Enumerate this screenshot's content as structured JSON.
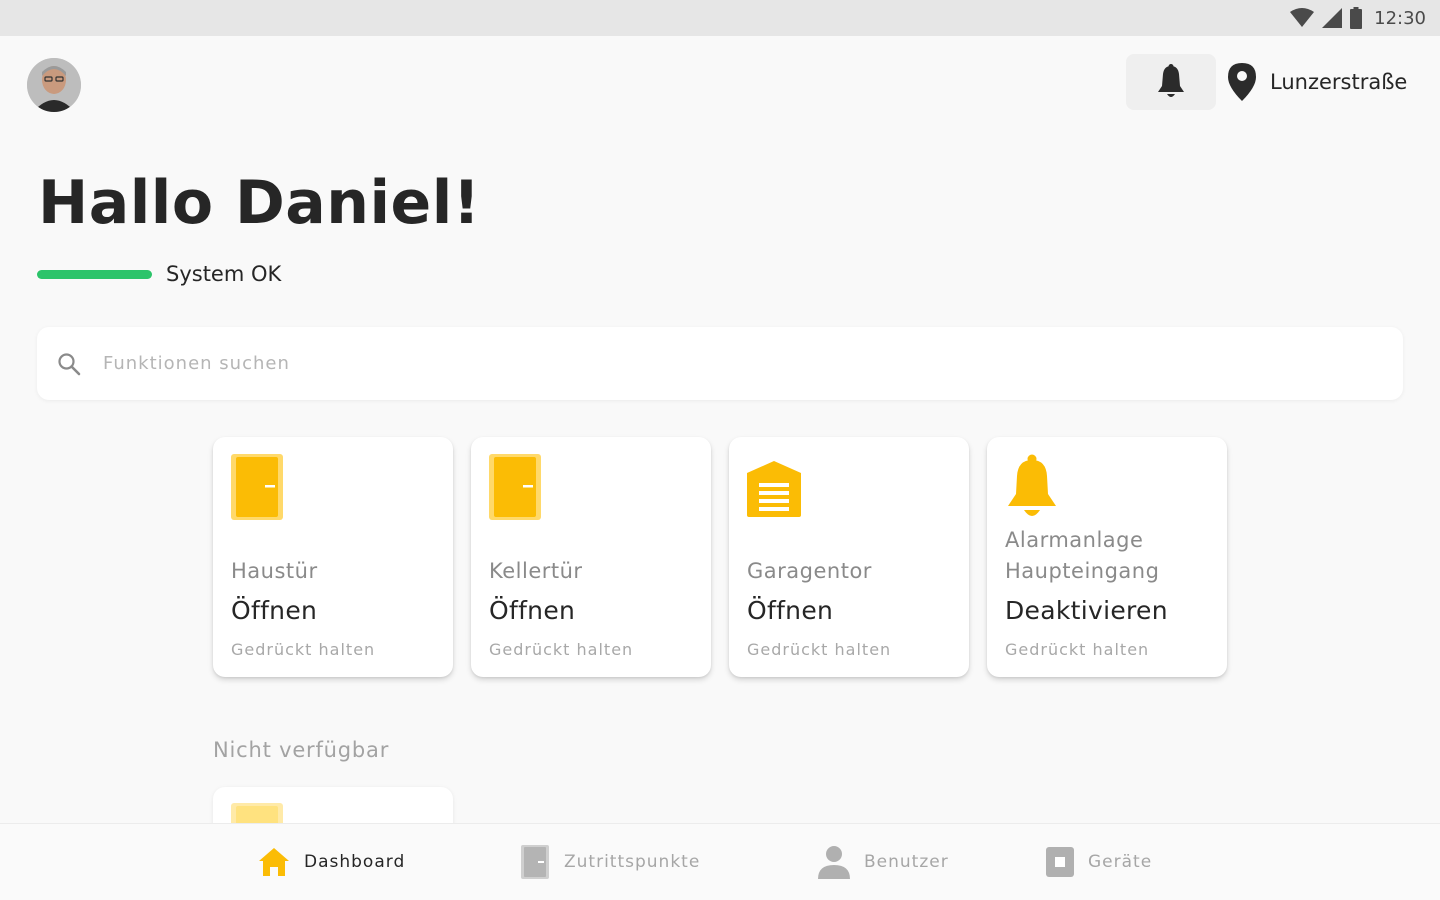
{
  "status_bar": {
    "time": "12:30"
  },
  "header": {
    "location": "Lunzerstraße"
  },
  "greeting": "Hallo Daniel!",
  "system_status": {
    "label": "System OK",
    "color": "#2cc46a"
  },
  "search": {
    "placeholder": "Funktionen suchen"
  },
  "cards": [
    {
      "name": "Haustür",
      "action": "Öffnen",
      "hint": "Gedrückt halten",
      "icon": "door-icon"
    },
    {
      "name": "Kellertür",
      "action": "Öffnen",
      "hint": "Gedrückt halten",
      "icon": "door-icon"
    },
    {
      "name": "Garagentor",
      "action": "Öffnen",
      "hint": "Gedrückt halten",
      "icon": "garage-icon"
    },
    {
      "name": "Alarmanlage Haupteingang",
      "action": "Deaktivieren",
      "hint": "Gedrückt halten",
      "icon": "alarm-bell-icon"
    }
  ],
  "unavailable_section": {
    "title": "Nicht verfügbar"
  },
  "bottom_nav": [
    {
      "label": "Dashboard",
      "icon": "home-icon",
      "active": true
    },
    {
      "label": "Zutrittspunkte",
      "icon": "door-icon",
      "active": false
    },
    {
      "label": "Benutzer",
      "icon": "user-icon",
      "active": false
    },
    {
      "label": "Geräte",
      "icon": "device-icon",
      "active": false
    }
  ],
  "colors": {
    "accent": "#fbbc05",
    "accent_light": "#ffd96a",
    "text": "#262626",
    "muted": "#a6a6a6"
  }
}
